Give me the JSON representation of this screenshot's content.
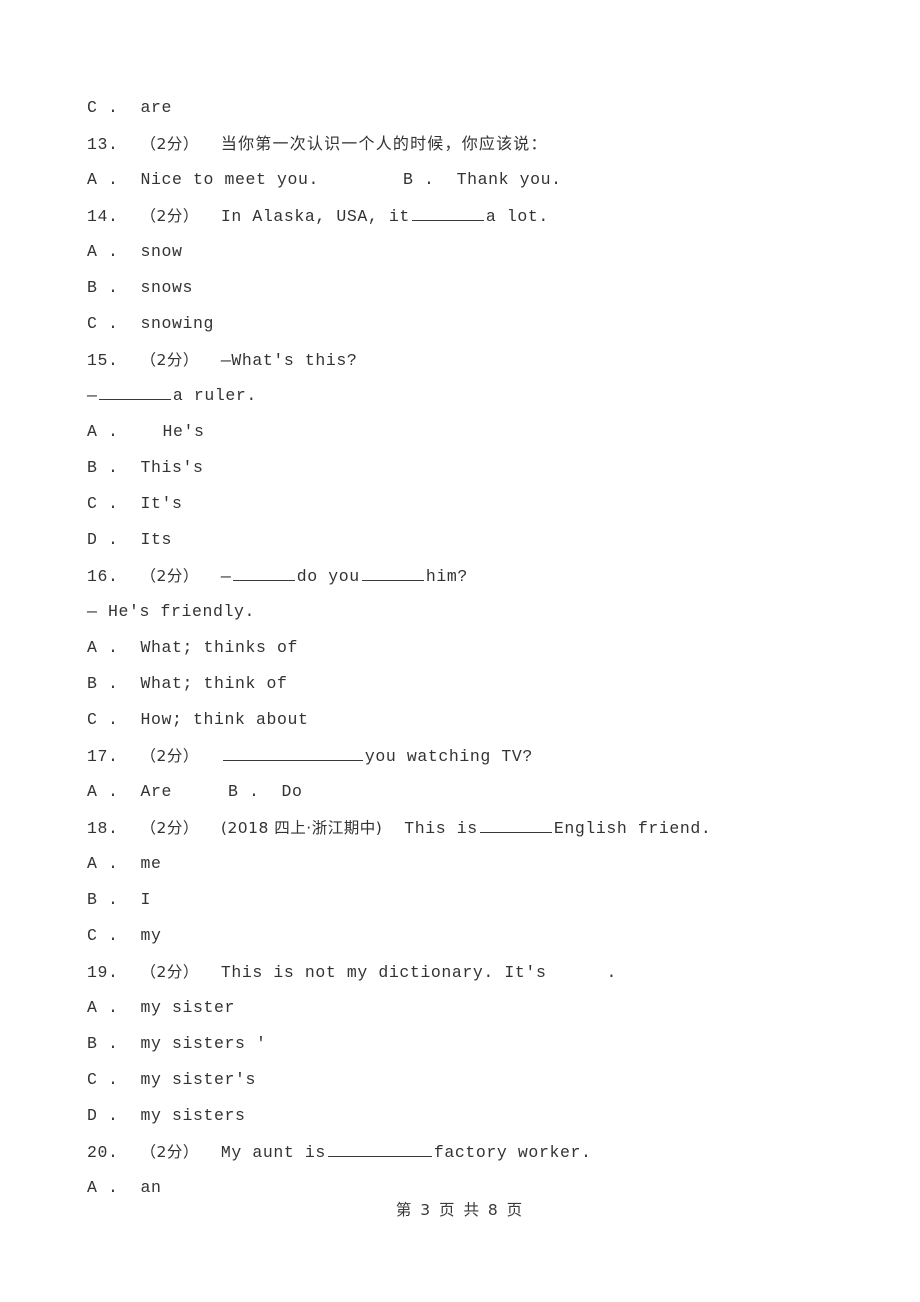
{
  "document": {
    "type": "exam-paper",
    "page_footer": "第 3 页 共 8 页",
    "score_tag": "（2分）"
  },
  "leading_option": {
    "label": "C .",
    "text": "are"
  },
  "questions": [
    {
      "number": "13.",
      "score": "（2分）",
      "stem_cjk": "当你第一次认识一个人的时候，你应该说：",
      "options_inline": [
        {
          "label": "A .",
          "text": "Nice to meet you."
        },
        {
          "label": "B .",
          "text": "Thank you."
        }
      ]
    },
    {
      "number": "14.",
      "score": "（2分）",
      "stem_before": "In Alaska, USA, it",
      "stem_after": "a lot.",
      "options": [
        {
          "label": "A .",
          "text": "snow"
        },
        {
          "label": "B .",
          "text": "snows"
        },
        {
          "label": "C .",
          "text": "snowing"
        }
      ]
    },
    {
      "number": "15.",
      "score": "（2分）",
      "stem_line1": "—What's this?",
      "stem_line2_dash": "—",
      "stem_line2_after": "a ruler.",
      "options": [
        {
          "label": "A .",
          "text": "He's"
        },
        {
          "label": "B .",
          "text": "This's"
        },
        {
          "label": "C .",
          "text": "It's"
        },
        {
          "label": "D .",
          "text": "Its"
        }
      ]
    },
    {
      "number": "16.",
      "score": "（2分）",
      "stem_dash": "—",
      "stem_mid": "do you",
      "stem_end": "him?",
      "answer_line": "— He's friendly.",
      "options": [
        {
          "label": "A .",
          "text": "What; thinks of"
        },
        {
          "label": "B .",
          "text": "What; think of"
        },
        {
          "label": "C .",
          "text": "How; think about"
        }
      ]
    },
    {
      "number": "17.",
      "score": "（2分）",
      "stem_after": "you watching TV?",
      "options_inline": [
        {
          "label": "A .",
          "text": "Are"
        },
        {
          "label": "B .",
          "text": "Do"
        }
      ]
    },
    {
      "number": "18.",
      "score": "（2分）",
      "source_tag": "(2018 四上·浙江期中)",
      "stem_before": "This is",
      "stem_after": "English friend.",
      "options": [
        {
          "label": "A .",
          "text": "me"
        },
        {
          "label": "B .",
          "text": "I"
        },
        {
          "label": "C .",
          "text": "my"
        }
      ]
    },
    {
      "number": "19.",
      "score": "（2分）",
      "stem_before": "This is not my dictionary. It's",
      "stem_after": ".",
      "options": [
        {
          "label": "A .",
          "text": "my sister"
        },
        {
          "label": "B .",
          "text": "my sisters '"
        },
        {
          "label": "C .",
          "text": "my sister's"
        },
        {
          "label": "D .",
          "text": "my sisters"
        }
      ]
    },
    {
      "number": "20.",
      "score": "（2分）",
      "stem_before": "My aunt is",
      "stem_after": "factory worker.",
      "options": [
        {
          "label": "A .",
          "text": "an"
        }
      ]
    }
  ]
}
